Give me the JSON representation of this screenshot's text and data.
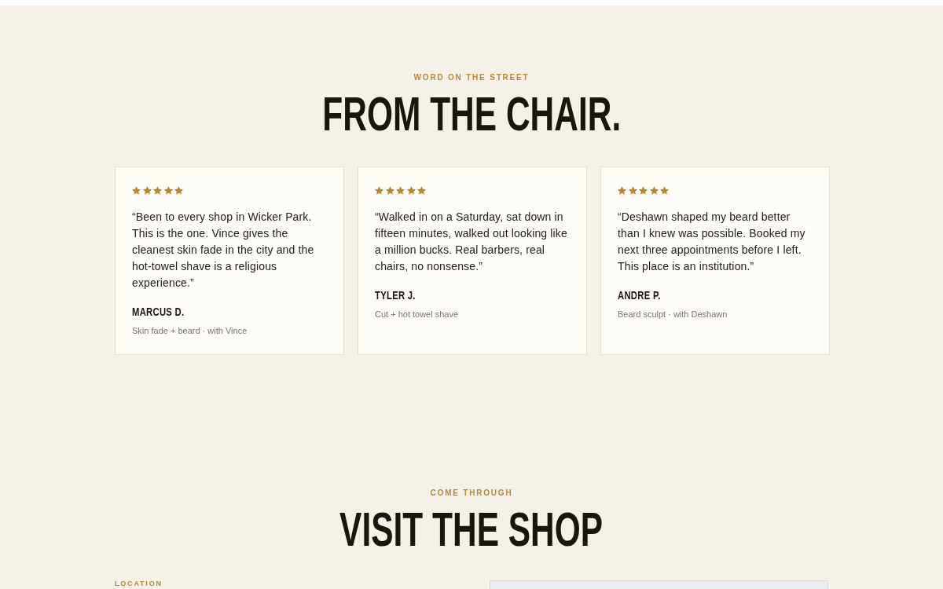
{
  "reviews_section": {
    "eyebrow": "WORD ON THE STREET",
    "title": "FROM THE CHAIR.",
    "reviews": [
      {
        "stars": 5,
        "quote": "“Been to every shop in Wicker Park. This is the one. Vince gives the cleanest skin fade in the city and the hot-towel shave is a religious experience.”",
        "name": "MARCUS D.",
        "detail": "Skin fade + beard · with Vince"
      },
      {
        "stars": 5,
        "quote": "“Walked in on a Saturday, sat down in fifteen minutes, walked out looking like a million bucks. Real barbers, real chairs, no nonsense.”",
        "name": "TYLER J.",
        "detail": "Cut + hot towel shave"
      },
      {
        "stars": 5,
        "quote": "“Deshawn shaped my beard better than I knew was possible. Booked my next three appointments before I left. This place is an institution.”",
        "name": "ANDRE P.",
        "detail": "Beard sculpt · with Deshawn"
      }
    ]
  },
  "visit_section": {
    "eyebrow": "COME THROUGH",
    "title": "VISIT THE SHOP",
    "location_label": "LOCATION"
  }
}
